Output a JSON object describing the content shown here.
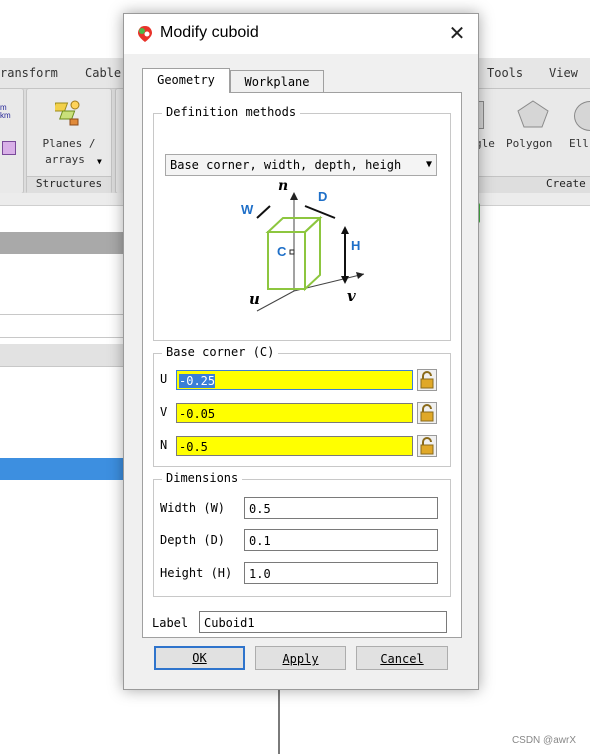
{
  "background": {
    "menu": [
      "ransform",
      "Cable",
      "Tools",
      "View"
    ],
    "planes_label_1": "Planes /",
    "planes_label_2": "arrays",
    "structures_label": "Structures",
    "create_label": "Create",
    "shapes_label_1": "gle",
    "shapes_label_2": "Polygon",
    "shapes_label_3": "Ell",
    "watermark": "CSDN @awrX",
    "icon_text_1": "m",
    "icon_text_2": "km"
  },
  "dialog": {
    "title": "Modify cuboid",
    "tabs": [
      "Geometry",
      "Workplane"
    ],
    "active_tab": "Geometry",
    "definition": {
      "group_label": "Definition methods",
      "selected": "Base corner, width, depth, heigh"
    },
    "diagram_labels": {
      "n": "n",
      "u": "u",
      "v": "v",
      "w": "W",
      "d": "D",
      "h": "H",
      "c": "C"
    },
    "base_corner": {
      "group_label": "Base corner (C)",
      "fields": [
        {
          "label": "U",
          "value": "-0.25",
          "selected": true
        },
        {
          "label": "V",
          "value": "-0.05"
        },
        {
          "label": "N",
          "value": "-0.5"
        }
      ]
    },
    "dimensions": {
      "group_label": "Dimensions",
      "fields": [
        {
          "label": "Width (W)",
          "value": "0.5"
        },
        {
          "label": "Depth (D)",
          "value": "0.1"
        },
        {
          "label": "Height (H)",
          "value": "1.0"
        }
      ]
    },
    "label_field": {
      "label": "Label",
      "value": "Cuboid1"
    },
    "buttons": {
      "ok": "OK",
      "apply": "Apply",
      "cancel": "Cancel"
    }
  },
  "colors": {
    "field_highlight": "#ffff00",
    "cube_green": "#8dc63f",
    "diagram_blue": "#1e6fc8",
    "selection_blue": "#3b7fd6"
  }
}
